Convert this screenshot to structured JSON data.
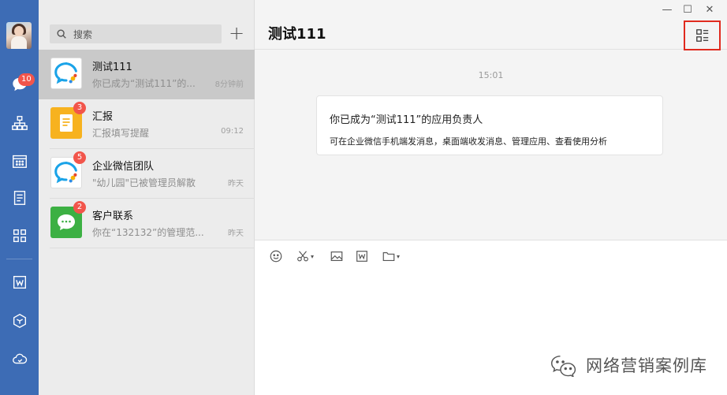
{
  "sidebar": {
    "chat_badge": "10"
  },
  "list": {
    "search_placeholder": "搜索",
    "add_label": "+",
    "conversations": [
      {
        "title": "测试111",
        "preview": "你已成为“测试111”的...",
        "time": "8分钟前",
        "badge": ""
      },
      {
        "title": "汇报",
        "preview": "汇报填写提醒",
        "time": "09:12",
        "badge": "3"
      },
      {
        "title": "企业微信团队",
        "preview": "\"幼儿园\"已被管理员解散",
        "time": "昨天",
        "badge": "5"
      },
      {
        "title": "客户联系",
        "preview": "你在“132132”的管理范...",
        "time": "昨天",
        "badge": "2"
      }
    ]
  },
  "chat": {
    "title": "测试111",
    "timestamp": "15:01",
    "system_message": {
      "line1": "你已成为“测试111”的应用负责人",
      "line2": "可在企业微信手机端发消息，桌面端收发消息、管理应用、查看使用分析"
    }
  },
  "window": {
    "minimize": "—",
    "maximize": "☐",
    "close": "✕"
  },
  "watermark": {
    "text": "网络营销案例库"
  },
  "colors": {
    "rail": "#3d6cb5",
    "badge": "#f2554b",
    "highlight_border": "#e02a1e"
  }
}
